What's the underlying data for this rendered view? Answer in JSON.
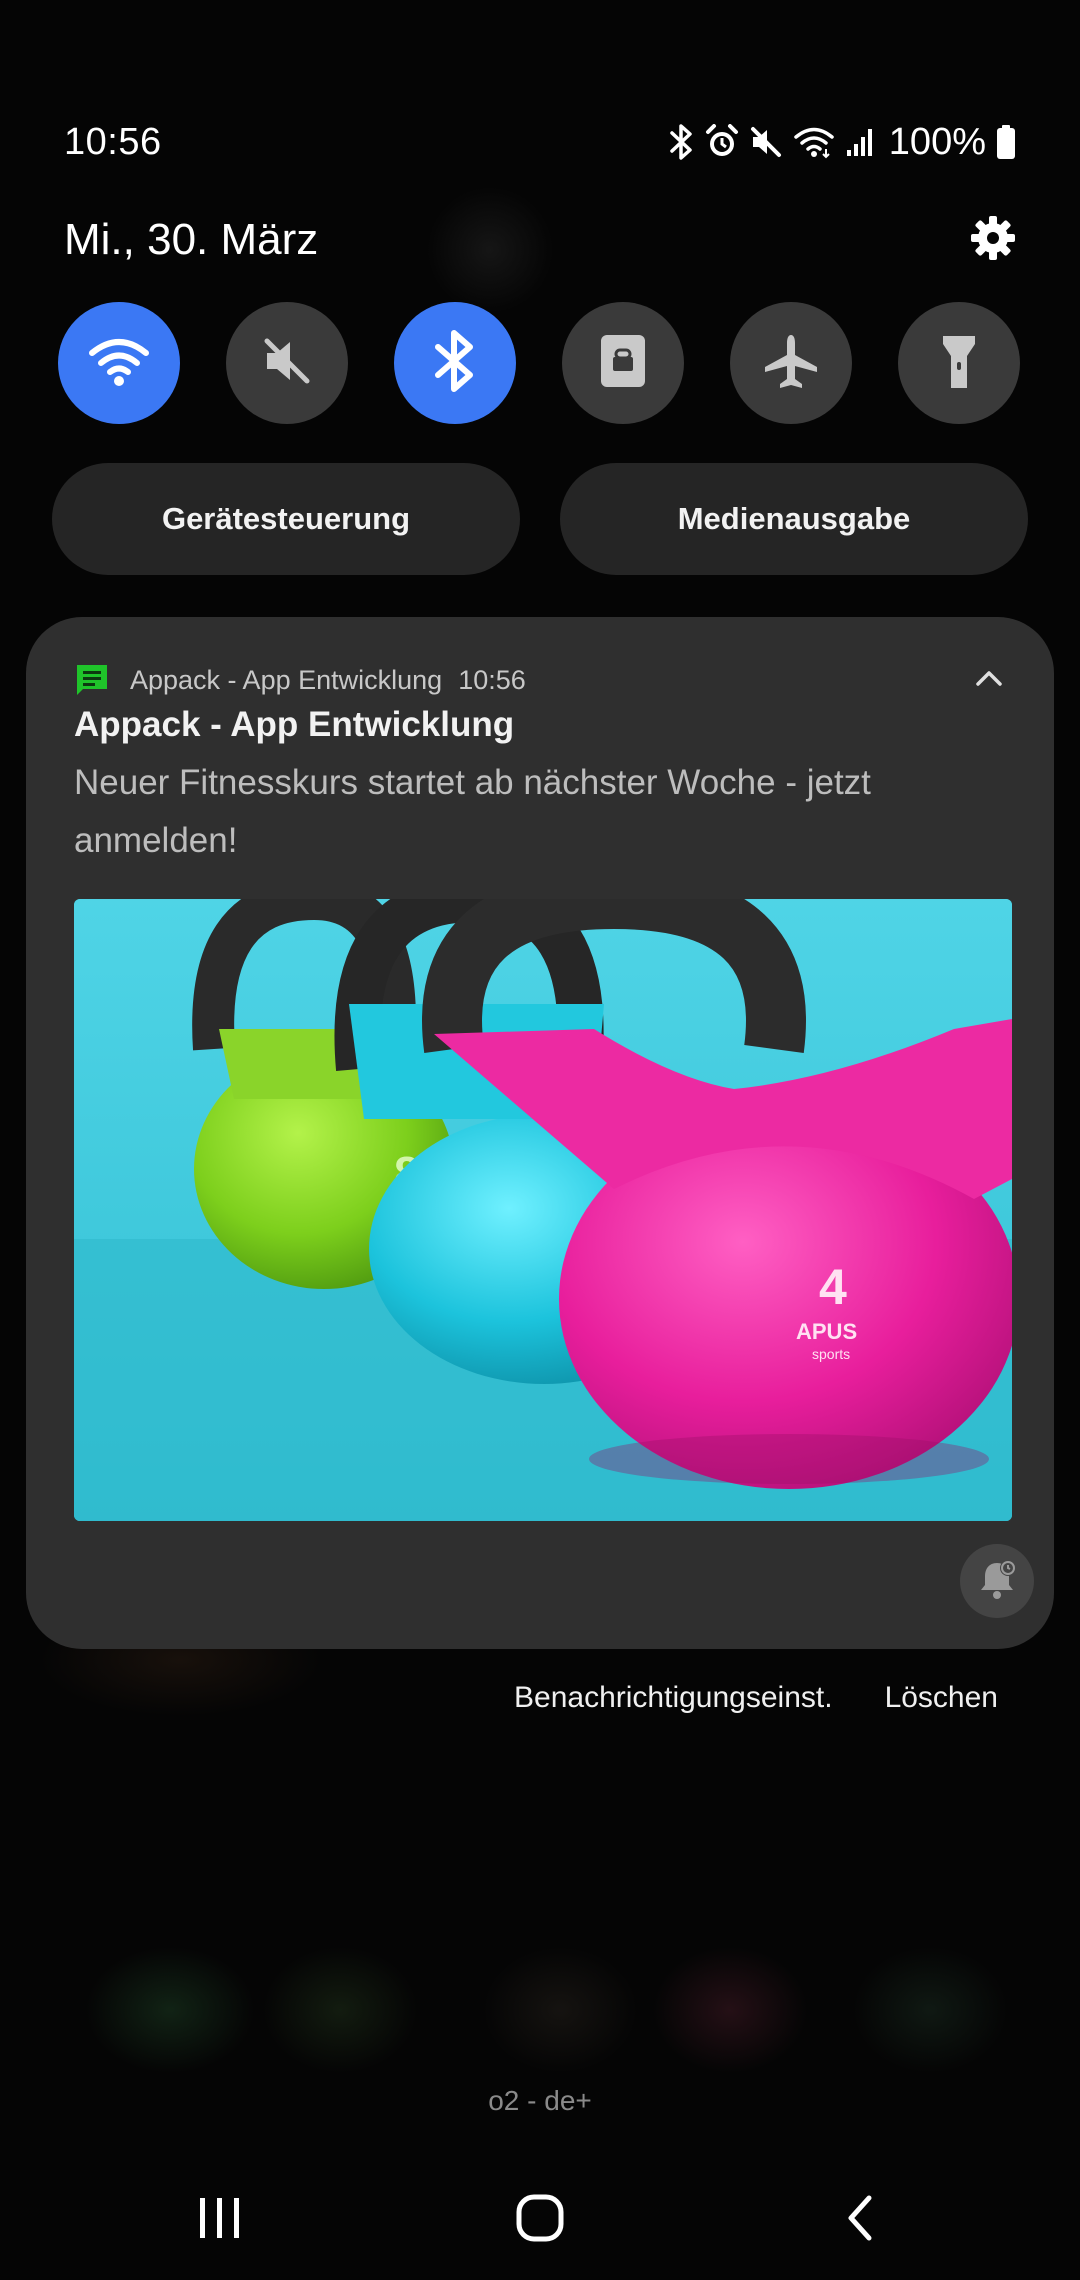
{
  "status_bar": {
    "time": "10:56",
    "battery": "100%",
    "icons": [
      "bluetooth-icon",
      "alarm-icon",
      "mute-icon",
      "wifi-icon",
      "signal-icon",
      "battery-icon"
    ]
  },
  "header": {
    "date": "Mi., 30. März",
    "settings_icon": "gear-icon"
  },
  "quick_toggles": [
    {
      "name": "wifi",
      "icon": "wifi-icon",
      "active": true
    },
    {
      "name": "sound",
      "icon": "mute-icon",
      "active": false
    },
    {
      "name": "bluetooth",
      "icon": "bluetooth-icon",
      "active": true
    },
    {
      "name": "screen-lock",
      "icon": "lock-icon",
      "active": false
    },
    {
      "name": "airplane-mode",
      "icon": "airplane-icon",
      "active": false
    },
    {
      "name": "flashlight",
      "icon": "flashlight-icon",
      "active": false
    }
  ],
  "pills": {
    "device_control": "Gerätesteuerung",
    "media_output": "Medienausgabe"
  },
  "notification": {
    "app_name": "Appack - App Entwicklung",
    "time": "10:56",
    "title": "Appack - App Entwicklung",
    "text": "Neuer Fitnesskurs startet ab nächster Woche - jetzt anmelden!",
    "image_labels": {
      "green_weight": "8",
      "pink_weight": "4",
      "brand": "APUS",
      "brand_sub": "sports"
    }
  },
  "actions": {
    "settings": "Benachrichtigungseinst.",
    "clear": "Löschen"
  },
  "carrier": "o2 - de+",
  "colors": {
    "accent": "#3b78f4",
    "toggle_off": "#3a3a3a",
    "card": "#2f2f2f",
    "app_icon": "#1fc42a"
  }
}
